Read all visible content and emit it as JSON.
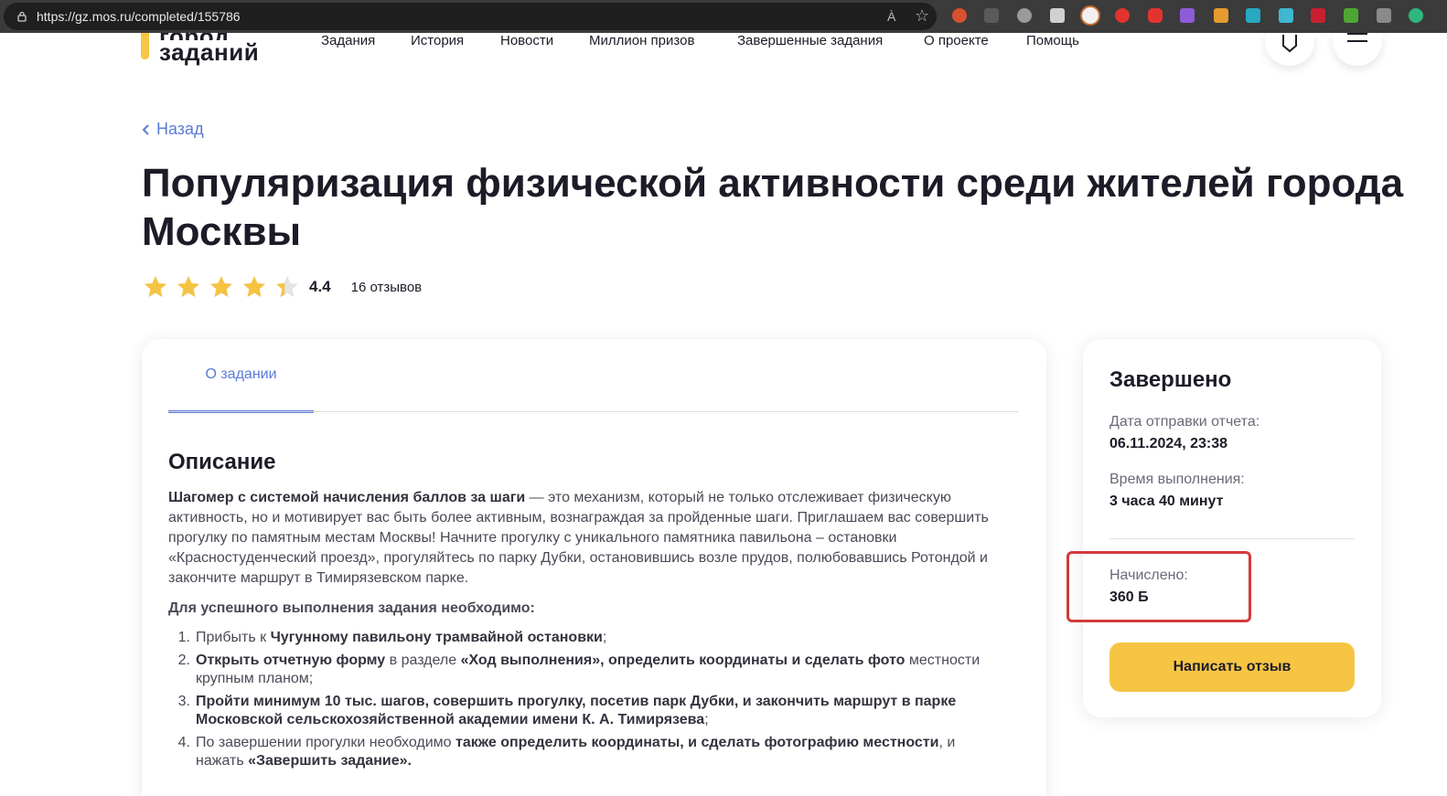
{
  "browser": {
    "url": "https://gz.mos.ru/completed/155786",
    "read_aloud": "À",
    "favorite": "☆"
  },
  "header": {
    "logo_line1": "город",
    "logo_line2": "заданий",
    "nav": [
      "Задания",
      "История",
      "Новости",
      "Миллион призов",
      "Завершенные задания",
      "О проекте",
      "Помощь"
    ]
  },
  "back_label": "Назад",
  "title": "Популяризация физической активности среди жителей города Москвы",
  "rating": {
    "value": "4.4",
    "stars": 4.4,
    "reviews": "16 отзывов"
  },
  "tabs": [
    "О задании"
  ],
  "description": {
    "title": "Описание",
    "lead_bold": "Шагомер с системой начисления баллов за шаги",
    "lead_rest": " — это механизм, который не только отслеживает физическую активность, но и мотивирует вас быть более активным, вознаграждая за пройденные шаги. Приглашаем вас совершить прогулку по памятным местам Москвы! Начните прогулку с уникального памятника павильона – остановки «Красностуденческий проезд», прогуляйтесь по парку Дубки, остановившись возле прудов, полюбовавшись Ротондой и закончите маршрут в Тимирязевском парке.",
    "requirements_title": "Для успешного выполнения задания необходимо:",
    "requirements": [
      {
        "n": "1.",
        "parts": [
          [
            "Прибыть к ",
            false
          ],
          [
            "Чугунному павильону трамвайной остановки",
            true
          ],
          [
            ";",
            false
          ]
        ]
      },
      {
        "n": "2.",
        "parts": [
          [
            "Открыть отчетную форму",
            true
          ],
          [
            " в разделе ",
            false
          ],
          [
            "«Ход выполнения», определить координаты и сделать фото",
            true
          ],
          [
            " местности крупным планом;",
            false
          ]
        ]
      },
      {
        "n": "3.",
        "parts": [
          [
            "Пройти минимум 10 тыс. шагов, совершить прогулку, посетив парк Дубки, и закончить маршрут в парке Московской сельскохозяйственной академии имени К. А. Тимирязева",
            true
          ],
          [
            ";",
            false
          ]
        ]
      },
      {
        "n": "4.",
        "parts": [
          [
            "По завершении прогулки необходимо ",
            false
          ],
          [
            "также определить координаты, и сделать фотографию местности",
            true
          ],
          [
            ", и нажать ",
            false
          ],
          [
            "«Завершить задание».",
            true
          ]
        ]
      }
    ]
  },
  "status": {
    "title": "Завершено",
    "report_date_label": "Дата отправки отчета:",
    "report_date": "06.11.2024, 23:38",
    "duration_label": "Время выполнения:",
    "duration": "3 часа 40 минут",
    "credited_label": "Начислено:",
    "credited": "360 Б",
    "review_button": "Написать отзыв"
  },
  "colors": {
    "accent_blue": "#5b7bd5",
    "accent_yellow": "#f6c544",
    "highlight_red": "#d33a3a",
    "star": "#f5c342"
  },
  "icons": [
    "lock-icon",
    "read-aloud-icon",
    "favorite-star-icon",
    "chevron-left-icon",
    "shield-icon",
    "menu-icon",
    "star-icon"
  ]
}
